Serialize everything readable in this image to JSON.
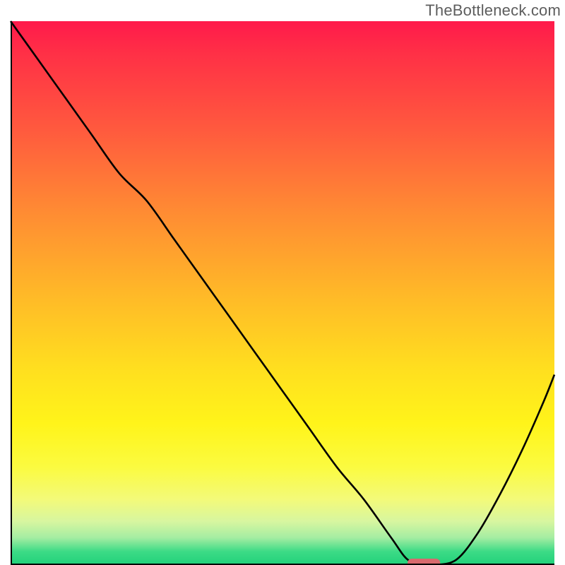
{
  "watermark": "TheBottleneck.com",
  "colors": {
    "axis": "#000000",
    "curve": "#000000",
    "marker": "#d86a6e",
    "watermark_text": "#5d5d5d"
  },
  "chart_data": {
    "type": "line",
    "title": "",
    "xlabel": "",
    "ylabel": "",
    "xlim": [
      0,
      100
    ],
    "ylim": [
      0,
      100
    ],
    "x": [
      0,
      5,
      10,
      15,
      20,
      25,
      30,
      35,
      40,
      45,
      50,
      55,
      60,
      65,
      70,
      73,
      76,
      78,
      82,
      86,
      90,
      94,
      98,
      100
    ],
    "y": [
      100,
      93,
      86,
      79,
      72,
      67,
      60,
      53,
      46,
      39,
      32,
      25,
      18,
      12,
      5,
      1,
      0,
      0,
      1,
      6,
      13,
      21,
      30,
      35
    ],
    "minimum_marker": {
      "x_start": 73,
      "x_end": 79,
      "y": 0
    },
    "annotations": []
  }
}
